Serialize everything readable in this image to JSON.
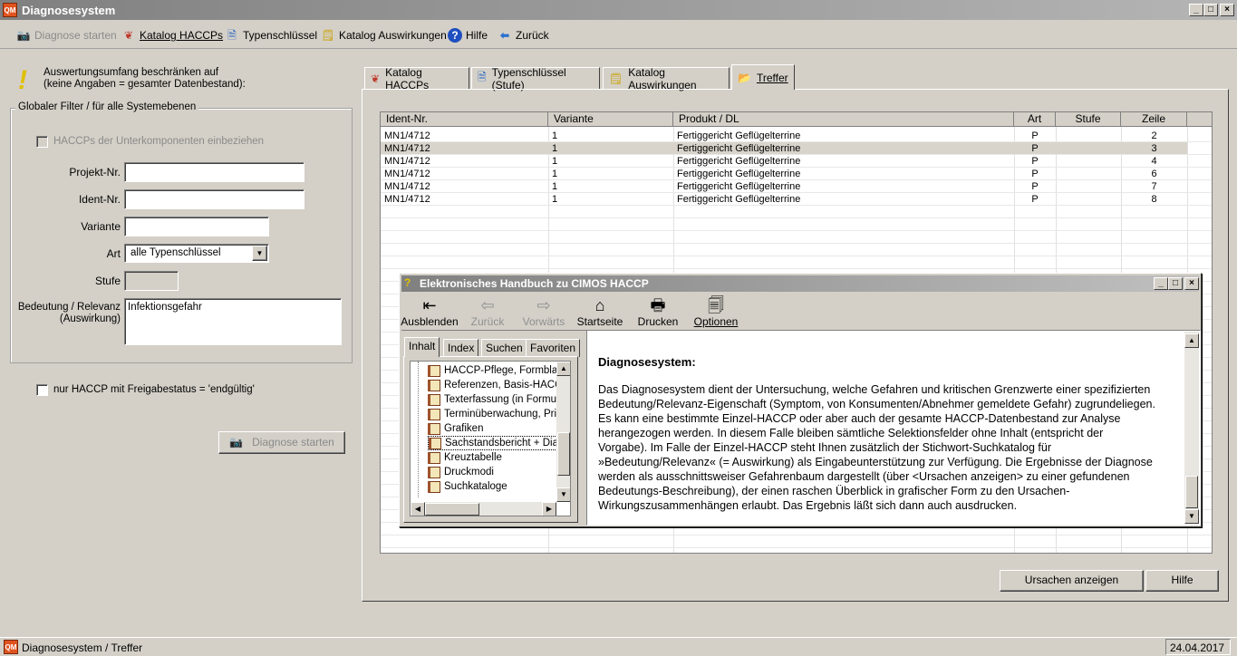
{
  "window": {
    "title": "Diagnosesystem",
    "app_icon": "QM"
  },
  "toolbar": {
    "diagnose_start": "Diagnose starten",
    "katalog_haccps": "Katalog HACCPs",
    "typenschluessel": "Typenschlüssel",
    "katalog_auswirkungen": "Katalog Auswirkungen",
    "hilfe": "Hilfe",
    "zurueck": "Zurück"
  },
  "left": {
    "hint_line1": "Auswertungsumfang beschränken auf",
    "hint_line2": "(keine Angaben = gesamter Datenbestand):",
    "group_title": "Globaler Filter / für alle Systemebenen",
    "haccp_sub_label": "HACCPs der Unterkomponenten einbeziehen",
    "projekt_label": "Projekt-Nr.",
    "projekt_value": "",
    "ident_label": "Ident-Nr.",
    "ident_value": "",
    "variante_label": "Variante",
    "variante_value": "",
    "art_label": "Art",
    "art_value": "alle Typenschlüssel",
    "stufe_label": "Stufe",
    "stufe_value": "",
    "bedeutung_label1": "Bedeutung / Relevanz",
    "bedeutung_label2": "(Auswirkung)",
    "bedeutung_value": "Infektionsgefahr",
    "freigabe_label": "nur HACCP mit Freigabestatus = 'endgültig'",
    "diagnose_button": "Diagnose starten"
  },
  "tabs": [
    {
      "label": "Katalog HACCPs"
    },
    {
      "label": "Typenschlüssel (Stufe)"
    },
    {
      "label": "Katalog Auswirkungen"
    },
    {
      "label": "Treffer"
    }
  ],
  "grid": {
    "headers": [
      "Ident-Nr.",
      "Variante",
      "Produkt / DL",
      "Art",
      "Stufe",
      "Zeile"
    ],
    "rows": [
      [
        "MN1/4712",
        "1",
        "Fertiggericht Geflügelterrine",
        "P",
        "",
        "2"
      ],
      [
        "MN1/4712",
        "1",
        "Fertiggericht Geflügelterrine",
        "P",
        "",
        "3"
      ],
      [
        "MN1/4712",
        "1",
        "Fertiggericht Geflügelterrine",
        "P",
        "",
        "4"
      ],
      [
        "MN1/4712",
        "1",
        "Fertiggericht Geflügelterrine",
        "P",
        "",
        "6"
      ],
      [
        "MN1/4712",
        "1",
        "Fertiggericht Geflügelterrine",
        "P",
        "",
        "7"
      ],
      [
        "MN1/4712",
        "1",
        "Fertiggericht Geflügelterrine",
        "P",
        "",
        "8"
      ]
    ]
  },
  "bottom_buttons": {
    "ursachen": "Ursachen anzeigen",
    "hilfe": "Hilfe"
  },
  "help": {
    "title": "Elektronisches Handbuch zu CIMOS HACCP",
    "toolbar": {
      "ausblenden": "Ausblenden",
      "zurueck": "Zurück",
      "vorwaerts": "Vorwärts",
      "startseite": "Startseite",
      "drucken": "Drucken",
      "optionen": "Optionen"
    },
    "tabs": [
      "Inhalt",
      "Index",
      "Suchen",
      "Favoriten"
    ],
    "tree": [
      "HACCP-Pflege, Formblatt",
      "Referenzen, Basis-HACC",
      "Texterfassung (in Formula",
      "Terminüberwachung, Prio",
      "Grafiken",
      "Sachstandsbericht + Diag",
      "Kreuztabelle",
      "Druckmodi",
      "Suchkataloge"
    ],
    "content_heading": "Diagnosesystem:",
    "content_lines": [
      "Das Diagnosesystem dient der Untersuchung, welche Gefahren und kritischen Grenzwerte einer spezifizierten",
      "Bedeutung/Relevanz-Eigenschaft (Symptom, von Konsumenten/Abnehmer gemeldete Gefahr) zugrundeliegen.",
      "Es kann eine bestimmte Einzel-HACCP oder aber auch der gesamte HACCP-Datenbestand zur Analyse",
      "herangezogen werden. In diesem Falle bleiben sämtliche Selektionsfelder ohne Inhalt (entspricht der",
      "Vorgabe). Im Falle der Einzel-HACCP steht Ihnen zusätzlich der Stichwort-Suchkatalog für",
      "»Bedeutung/Relevanz« (= Auswirkung) als Eingabeunterstützung zur Verfügung. Die Ergebnisse der Diagnose",
      "werden als ausschnittsweiser Gefahrenbaum dargestellt (über <Ursachen anzeigen> zu einer gefundenen",
      "Bedeutungs-Beschreibung), der einen raschen Überblick in grafischer Form zu den Ursachen-",
      "Wirkungszusammenhängen erlaubt. Das Ergebnis läßt sich dann auch ausdrucken."
    ]
  },
  "status": {
    "left": "Diagnosesystem / Treffer",
    "date": "24.04.2017"
  }
}
